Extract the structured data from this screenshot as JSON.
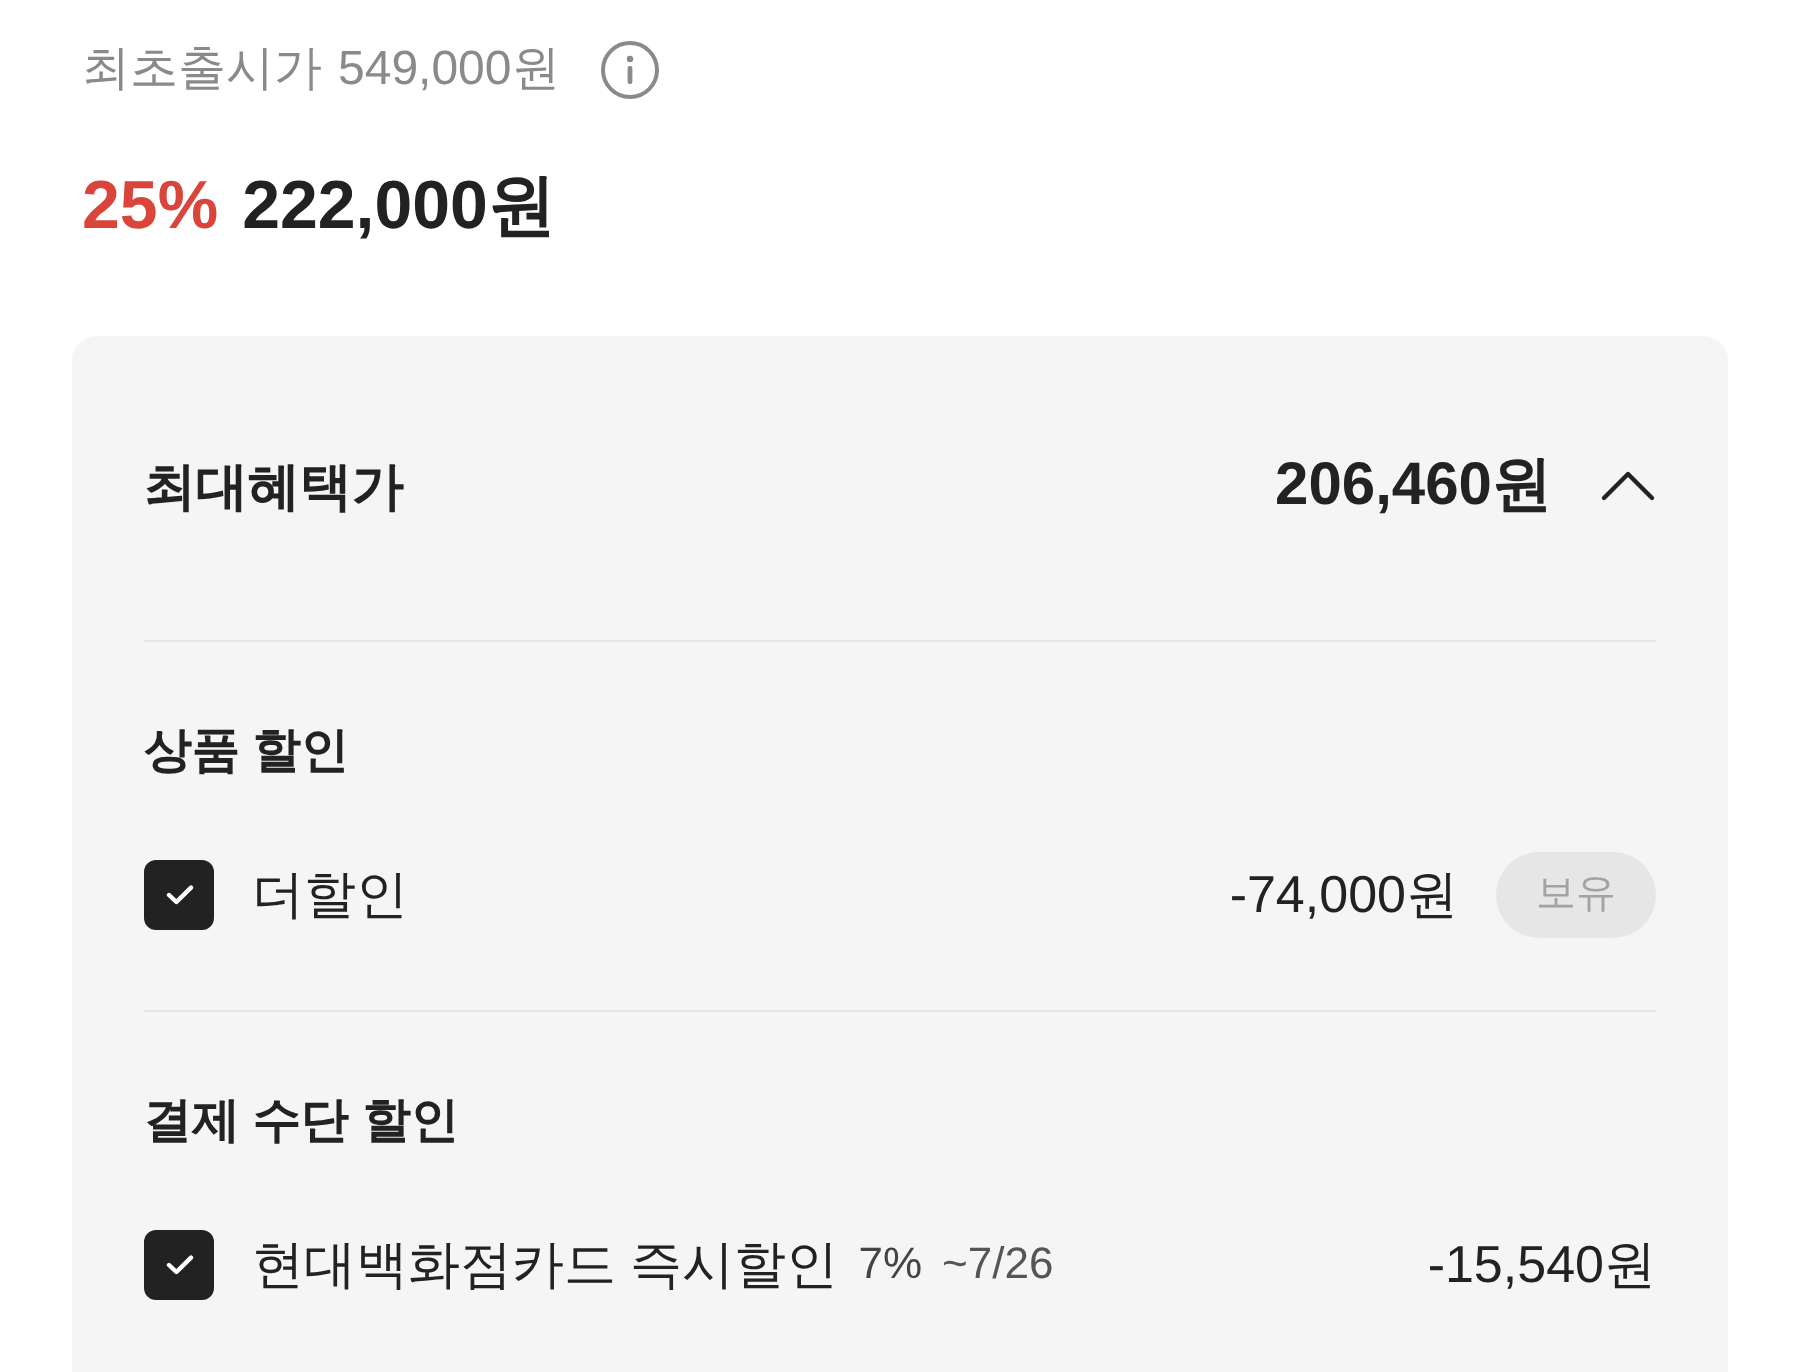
{
  "original_price": {
    "label": "최초출시가",
    "value": "549,000원"
  },
  "price": {
    "discount": "25%",
    "value": "222,000원"
  },
  "benefit_panel": {
    "title": "최대혜택가",
    "total": "206,460원",
    "expanded": true,
    "sections": [
      {
        "title": "상품 할인",
        "items": [
          {
            "label": "더할인",
            "amount": "-74,000원",
            "checked": true,
            "badge": "보유"
          }
        ]
      },
      {
        "title": "결제 수단 할인",
        "items": [
          {
            "label": "현대백화점카드 즉시할인",
            "rate": "7%",
            "period": "~7/26",
            "amount": "-15,540원",
            "checked": true
          }
        ]
      }
    ]
  }
}
